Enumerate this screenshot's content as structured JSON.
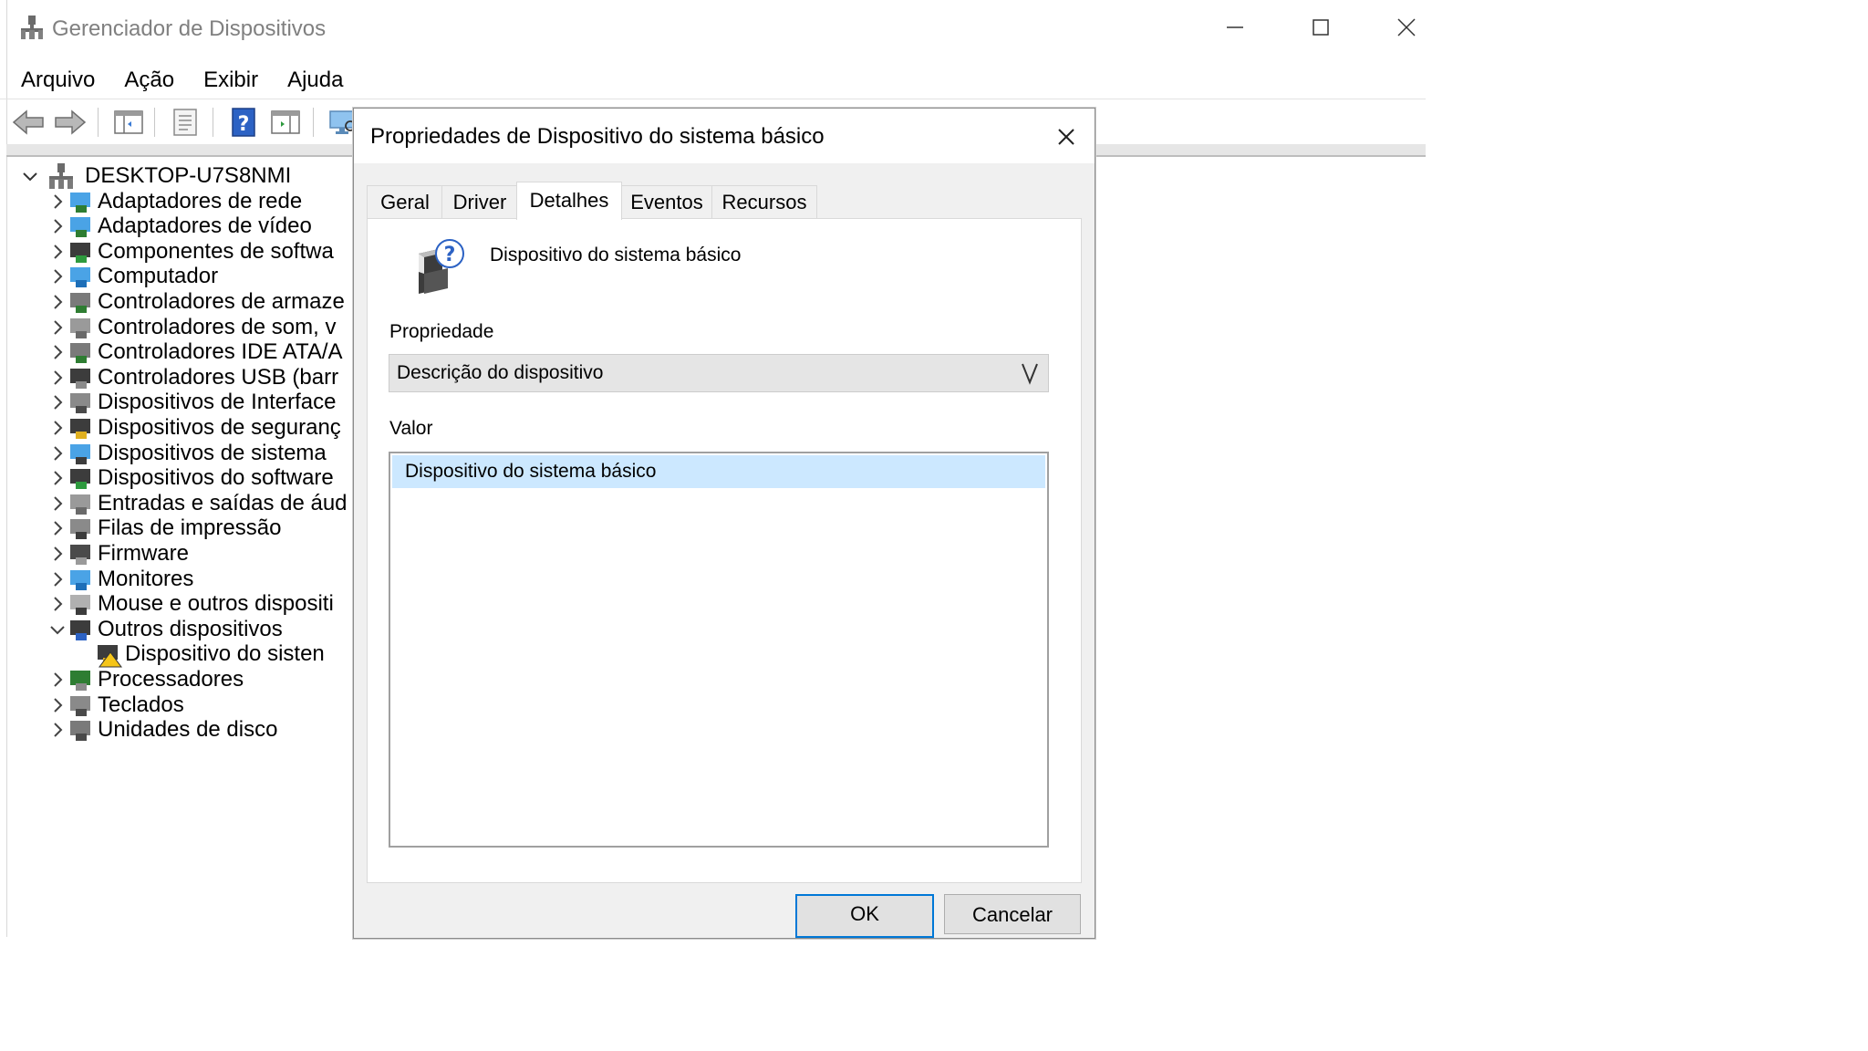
{
  "window": {
    "title": "Gerenciador de Dispositivos",
    "controls": [
      "minimize-icon",
      "maximize-icon",
      "close-icon"
    ]
  },
  "menu": [
    "Arquivo",
    "Ação",
    "Exibir",
    "Ajuda"
  ],
  "toolbar": {
    "buttons": [
      "back-arrow-icon",
      "forward-arrow-icon",
      "show-hide-console-tree-icon",
      "properties-icon",
      "help-icon",
      "action-pane-icon",
      "scan-hardware-icon"
    ]
  },
  "tree": {
    "root": "DESKTOP-U7S8NMI",
    "items": [
      {
        "label": "Adaptadores de rede",
        "icon": "network-adapter-icon",
        "expanded": false
      },
      {
        "label": "Adaptadores de vídeo",
        "icon": "display-adapter-icon",
        "expanded": false
      },
      {
        "label": "Componentes de softwa",
        "icon": "software-component-icon",
        "expanded": false
      },
      {
        "label": "Computador",
        "icon": "computer-icon",
        "expanded": false
      },
      {
        "label": "Controladores de armaze",
        "icon": "storage-controller-icon",
        "expanded": false
      },
      {
        "label": "Controladores de som, v",
        "icon": "sound-controller-icon",
        "expanded": false
      },
      {
        "label": "Controladores IDE ATA/A",
        "icon": "ide-controller-icon",
        "expanded": false
      },
      {
        "label": "Controladores USB (barr",
        "icon": "usb-controller-icon",
        "expanded": false
      },
      {
        "label": "Dispositivos de Interface",
        "icon": "hid-icon",
        "expanded": false
      },
      {
        "label": "Dispositivos de seguranç",
        "icon": "security-device-icon",
        "expanded": false
      },
      {
        "label": "Dispositivos de sistema",
        "icon": "system-device-icon",
        "expanded": false
      },
      {
        "label": "Dispositivos do software",
        "icon": "software-device-icon",
        "expanded": false
      },
      {
        "label": "Entradas e saídas de áud",
        "icon": "audio-io-icon",
        "expanded": false
      },
      {
        "label": "Filas de impressão",
        "icon": "printer-icon",
        "expanded": false
      },
      {
        "label": "Firmware",
        "icon": "firmware-icon",
        "expanded": false
      },
      {
        "label": "Monitores",
        "icon": "monitor-icon",
        "expanded": false
      },
      {
        "label": "Mouse e outros dispositi",
        "icon": "mouse-icon",
        "expanded": false
      },
      {
        "label": "Outros dispositivos",
        "icon": "unknown-device-icon",
        "expanded": true
      },
      {
        "label": "Dispositivo do sisten",
        "icon": "warning-device-icon",
        "child": true
      },
      {
        "label": "Processadores",
        "icon": "processor-icon",
        "expanded": false
      },
      {
        "label": "Teclados",
        "icon": "keyboard-icon",
        "expanded": false
      },
      {
        "label": "Unidades de disco",
        "icon": "disk-drive-icon",
        "expanded": false
      }
    ]
  },
  "dialog": {
    "title": "Propriedades de Dispositivo do sistema básico",
    "tabs": [
      "Geral",
      "Driver",
      "Detalhes",
      "Eventos",
      "Recursos"
    ],
    "active_tab": "Detalhes",
    "device_name": "Dispositivo do sistema básico",
    "property_label": "Propriedade",
    "property_value": "Descrição do dispositivo",
    "value_label": "Valor",
    "values": [
      "Dispositivo do sistema básico"
    ],
    "ok": "OK",
    "cancel": "Cancelar"
  },
  "colors": {
    "selection": "#cce8ff",
    "default_button_border": "#0078d7",
    "dialog_bg": "#f0f0f0"
  }
}
